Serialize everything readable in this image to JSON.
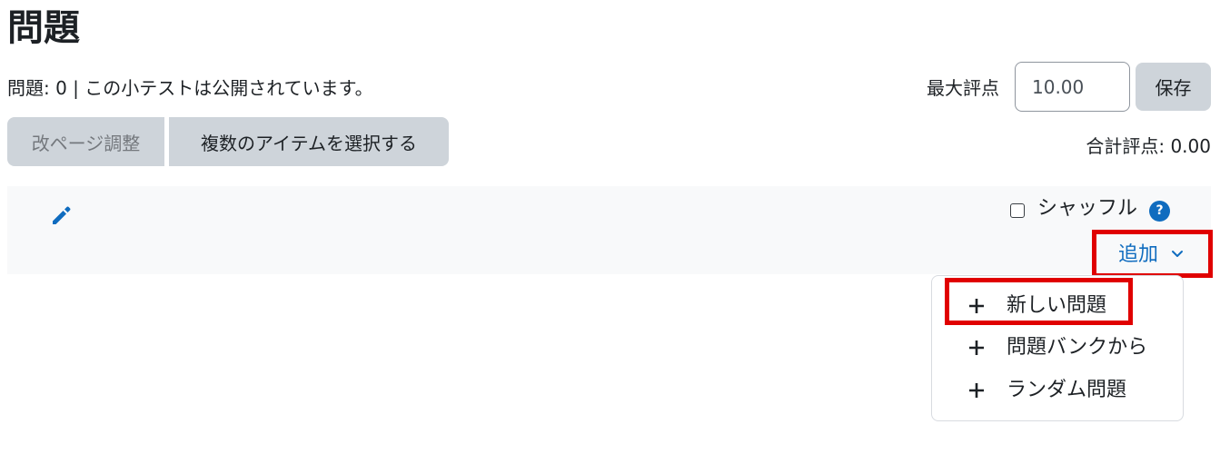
{
  "page": {
    "title": "問題",
    "status": "問題: 0 | この小テストは公開されています。"
  },
  "grading": {
    "max_grade_label": "最大評点",
    "max_grade_value": "10.00",
    "save_label": "保存",
    "total_label": "合計評点: 0.00"
  },
  "toolbar": {
    "repaginate_label": "改ページ調整",
    "select_multiple_label": "複数のアイテムを選択する"
  },
  "section": {
    "edit_icon": "pencil-icon",
    "shuffle_label": "シャッフル",
    "shuffle_checked": false,
    "help_icon": "question-circle-icon",
    "help_glyph": "?"
  },
  "add_menu": {
    "toggle_label": "追加",
    "toggle_icon": "chevron-down-icon",
    "items": [
      {
        "label": "新しい問題",
        "icon": "plus-icon"
      },
      {
        "label": "問題バンクから",
        "icon": "plus-icon"
      },
      {
        "label": "ランダム問題",
        "icon": "plus-icon"
      }
    ]
  },
  "colors": {
    "link": "#0f6cbf",
    "button_bg": "#ced4da",
    "panel_bg": "#f8f9fa",
    "highlight": "#e00000"
  }
}
